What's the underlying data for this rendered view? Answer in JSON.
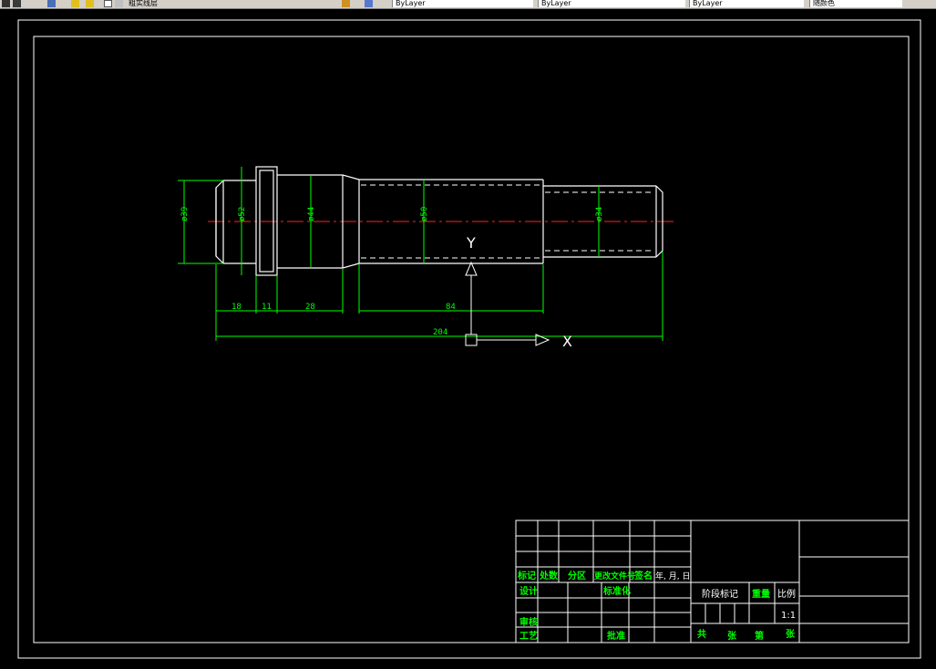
{
  "toolbar": {
    "layer_name": "粗实线层",
    "dropdown_1": "ByLayer",
    "dropdown_2": "ByLayer",
    "dropdown_3": "ByLayer",
    "dropdown_4": "随颜色"
  },
  "drawing": {
    "dimensions": {
      "d1": "ø39",
      "d2": "ø52",
      "d3": "ø44",
      "d4": "ø50",
      "d5": "ø34",
      "l1": "18",
      "l2": "11",
      "l3": "28",
      "l4": "84",
      "total": "204"
    },
    "ucs": {
      "y": "Y",
      "x": "X"
    }
  },
  "title_block": {
    "mark": "标记",
    "count": "处数",
    "zone": "分区",
    "change_doc": "更改文件号",
    "signature": "签名",
    "date": "年, 月, 日",
    "design": "设计",
    "standardization": "标准化",
    "review": "审核",
    "process": "工艺",
    "approve": "批准",
    "stage_mark": "阶段标记",
    "weight": "重量",
    "scale": "比例",
    "scale_value": "1:1",
    "total": "共",
    "sheets": "张",
    "sheet_no": "第",
    "page": "张"
  }
}
